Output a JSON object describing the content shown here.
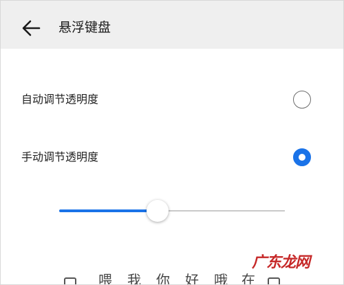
{
  "header": {
    "title": "悬浮键盘",
    "back_icon": "arrow-left-icon"
  },
  "options": [
    {
      "label": "自动调节透明度",
      "selected": false
    },
    {
      "label": "手动调节透明度",
      "selected": true
    }
  ],
  "slider": {
    "value": 0.435
  },
  "keyboard_row": [
    "喂",
    "我",
    "你",
    "好",
    "哦",
    "在"
  ],
  "watermark": "广东龙网",
  "colors": {
    "accent": "#1a73e8",
    "header_bg": "#efefef",
    "watermark": "#c62828"
  }
}
